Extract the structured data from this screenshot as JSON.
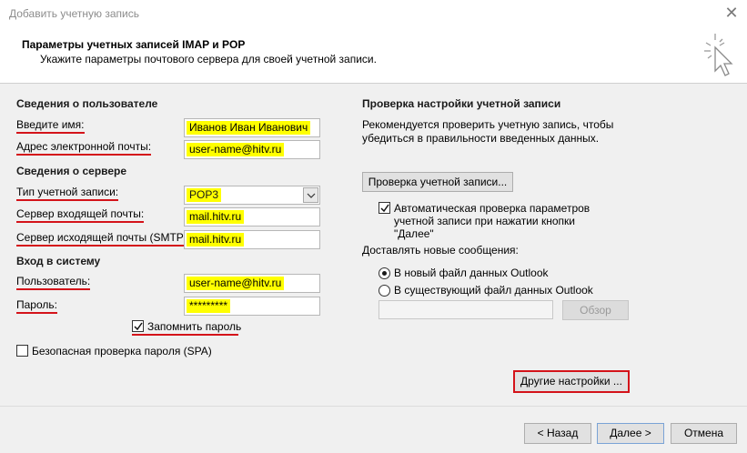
{
  "window": {
    "title": "Добавить учетную запись",
    "close_glyph": "✕"
  },
  "header": {
    "title": "Параметры учетных записей IMAP и POP",
    "subtitle": "Укажите параметры почтового сервера для своей учетной записи.",
    "icon": "cursor-click-icon"
  },
  "user_info": {
    "heading": "Сведения о пользователе",
    "name_label": "Введите имя:",
    "name_value": "Иванов Иван Иванович",
    "email_label": "Адрес электронной почты:",
    "email_value": "user-name@hitv.ru"
  },
  "server_info": {
    "heading": "Сведения о сервере",
    "account_type_label": "Тип учетной записи:",
    "account_type_value": "POP3",
    "incoming_label": "Сервер входящей почты:",
    "incoming_value": "mail.hitv.ru",
    "outgoing_label": "Сервер исходящей почты (SMTP):",
    "outgoing_value": "mail.hitv.ru"
  },
  "login": {
    "heading": "Вход в систему",
    "user_label": "Пользователь:",
    "user_value": "user-name@hitv.ru",
    "password_label": "Пароль:",
    "password_value": "*********",
    "remember_label": "Запомнить пароль",
    "remember_checked": true,
    "spa_label": "Безопасная проверка пароля (SPA)",
    "spa_checked": false
  },
  "test": {
    "heading": "Проверка настройки учетной записи",
    "description_line1": "Рекомендуется проверить учетную запись, чтобы",
    "description_line2": "убедиться в правильности введенных данных.",
    "test_button": "Проверка учетной записи...",
    "auto_check_line1": "Автоматическая проверка параметров",
    "auto_check_line2": "учетной записи при нажатии кнопки",
    "auto_check_line3": "\"Далее\"",
    "auto_check_checked": true
  },
  "deliver": {
    "heading": "Доставлять новые сообщения:",
    "option_new": "В новый файл данных Outlook",
    "option_existing": "В существующий файл данных Outlook",
    "selected": "option_new",
    "path_value": "",
    "browse_button": "Обзор"
  },
  "more_settings_button": "Другие настройки ...",
  "footer": {
    "back_button": "< Назад",
    "next_button": "Далее >",
    "cancel_button": "Отмена"
  },
  "colors": {
    "highlight": "#ffff00",
    "annotation_red": "#d4131a",
    "dialog_bg": "#f0f0f0"
  }
}
